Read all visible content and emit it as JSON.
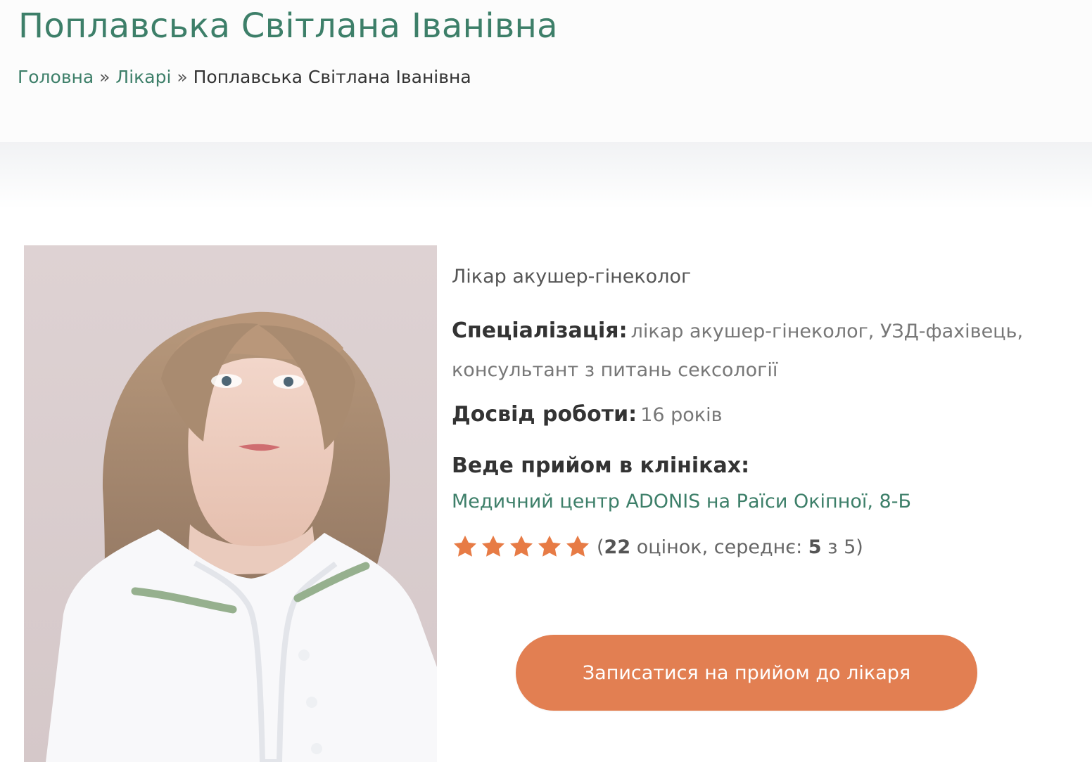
{
  "page": {
    "title": "Поплавська Світлана Іванівна"
  },
  "breadcrumb": {
    "items": [
      {
        "label": "Головна"
      },
      {
        "label": "Лікарі"
      },
      {
        "label": "Поплавська Світлана Іванівна"
      }
    ],
    "separator": "»"
  },
  "doctor": {
    "position": "Лікар акушер-гінеколог",
    "specialization_label": "Спеціалізація:",
    "specialization_value": "лікар акушер-гінеколог, УЗД-фахівець, консультант з питань сексології",
    "experience_label": "Досвід роботи:",
    "experience_value": "16 років",
    "clinics_label": "Веде прийом в клініках:",
    "clinic_name": "Медичний центр ADONIS на Раїси Окіпної, 8-Б"
  },
  "rating": {
    "stars_filled": 5,
    "stars_total": 5,
    "open_paren": "(",
    "count": "22",
    "count_text": " оцінок, середнє: ",
    "average": "5",
    "of_text": " з 5)"
  },
  "actions": {
    "appointment_label": "Записатися на прийом до лікаря"
  },
  "colors": {
    "accent_green": "#3d7f69",
    "button_orange": "#e27f52",
    "star_orange": "#e77b45"
  },
  "icons": {
    "star": "star-icon"
  }
}
